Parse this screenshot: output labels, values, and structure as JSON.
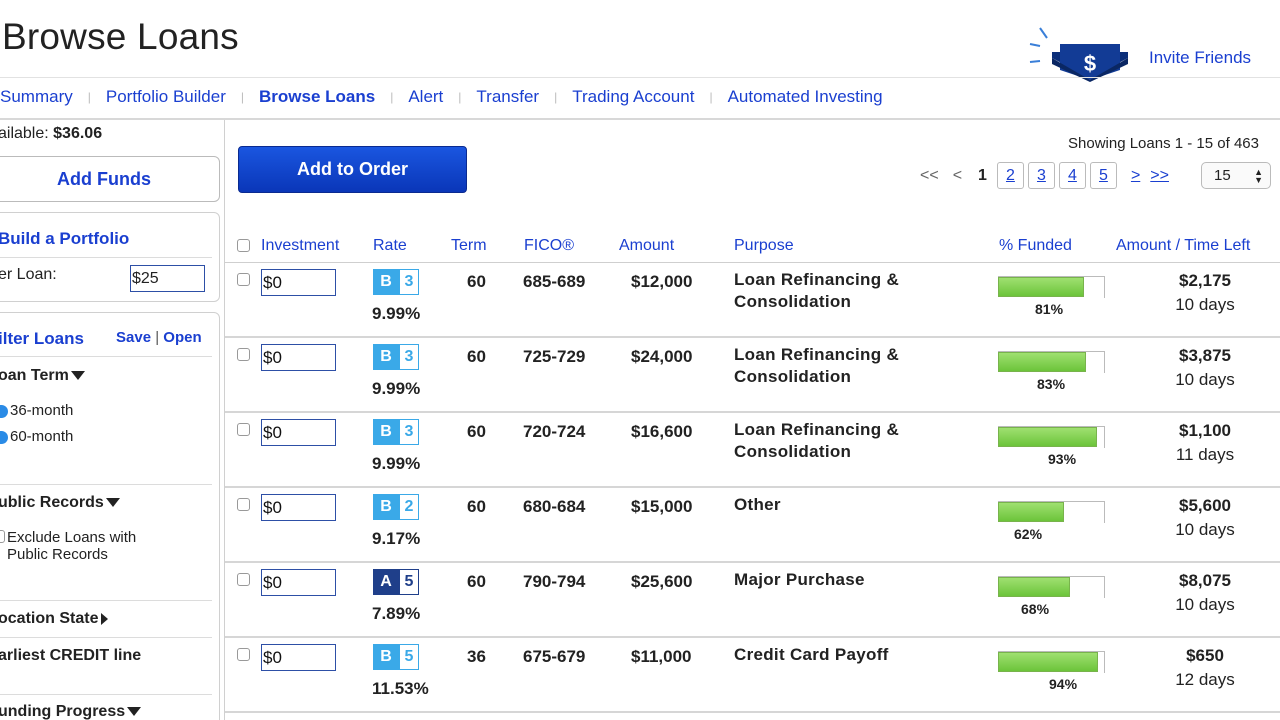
{
  "header": {
    "title": "Browse Loans",
    "invite_label": "Invite Friends",
    "invite_icon_symbol": "$"
  },
  "nav": [
    {
      "label": "Summary",
      "active": false
    },
    {
      "label": "Portfolio Builder",
      "active": false
    },
    {
      "label": "Browse Loans",
      "active": true
    },
    {
      "label": "Alert",
      "active": false
    },
    {
      "label": "Transfer",
      "active": false
    },
    {
      "label": "Trading Account",
      "active": false
    },
    {
      "label": "Automated Investing",
      "active": false
    }
  ],
  "sidebar": {
    "available_label": "ailable:",
    "available_value": "$36.06",
    "add_funds": "Add Funds",
    "build_portfolio": "Build a Portfolio",
    "per_loan_label": "er Loan:",
    "per_loan_value": "$25",
    "filter_loans": "ilter Loans",
    "save": "Save",
    "open": "Open",
    "loan_term": "oan Term",
    "term_36": "36-month",
    "term_60": "60-month",
    "public_records": "ublic Records",
    "exclude_public": "Exclude Loans with Public Records",
    "location_state": "ocation State",
    "earliest_credit": "arliest CREDIT line",
    "funding_progress": "unding Progress"
  },
  "toolbar": {
    "add_to_order": "Add to Order",
    "showing": "Showing Loans 1 - 15 of 463",
    "first": "<<",
    "prev": "<",
    "current_page": "1",
    "pages": [
      "2",
      "3",
      "4",
      "5"
    ],
    "next": ">",
    "last": ">>",
    "per_page": "15"
  },
  "table": {
    "headers": {
      "investment": "Investment",
      "rate": "Rate",
      "term": "Term",
      "fico": "FICO®",
      "amount": "Amount",
      "purpose": "Purpose",
      "funded": "% Funded",
      "amount_time": "Amount / Time Left"
    },
    "rows": [
      {
        "investment": "$0",
        "grade": "B",
        "subgrade": "3",
        "rate": "9.99%",
        "term": "60",
        "fico": "685-689",
        "amount": "$12,000",
        "purpose": "Loan Refinancing & Consolidation",
        "funded_pct": 81,
        "funded_label": "81%",
        "amount_left": "$2,175",
        "time_left": "10 days"
      },
      {
        "investment": "$0",
        "grade": "B",
        "subgrade": "3",
        "rate": "9.99%",
        "term": "60",
        "fico": "725-729",
        "amount": "$24,000",
        "purpose": "Loan Refinancing & Consolidation",
        "funded_pct": 83,
        "funded_label": "83%",
        "amount_left": "$3,875",
        "time_left": "10 days"
      },
      {
        "investment": "$0",
        "grade": "B",
        "subgrade": "3",
        "rate": "9.99%",
        "term": "60",
        "fico": "720-724",
        "amount": "$16,600",
        "purpose": "Loan Refinancing & Consolidation",
        "funded_pct": 93,
        "funded_label": "93%",
        "amount_left": "$1,100",
        "time_left": "11 days"
      },
      {
        "investment": "$0",
        "grade": "B",
        "subgrade": "2",
        "rate": "9.17%",
        "term": "60",
        "fico": "680-684",
        "amount": "$15,000",
        "purpose": "Other",
        "funded_pct": 62,
        "funded_label": "62%",
        "amount_left": "$5,600",
        "time_left": "10 days"
      },
      {
        "investment": "$0",
        "grade": "A",
        "subgrade": "5",
        "rate": "7.89%",
        "term": "60",
        "fico": "790-794",
        "amount": "$25,600",
        "purpose": "Major Purchase",
        "funded_pct": 68,
        "funded_label": "68%",
        "amount_left": "$8,075",
        "time_left": "10 days"
      },
      {
        "investment": "$0",
        "grade": "B",
        "subgrade": "5",
        "rate": "11.53%",
        "term": "36",
        "fico": "675-679",
        "amount": "$11,000",
        "purpose": "Credit Card Payoff",
        "funded_pct": 94,
        "funded_label": "94%",
        "amount_left": "$650",
        "time_left": "12 days"
      }
    ]
  },
  "colors": {
    "grade_B": "#3aa9e8",
    "grade_A": "#1f3f8a",
    "link": "#1a3fd0",
    "bar_fill": "#7fce4a"
  }
}
